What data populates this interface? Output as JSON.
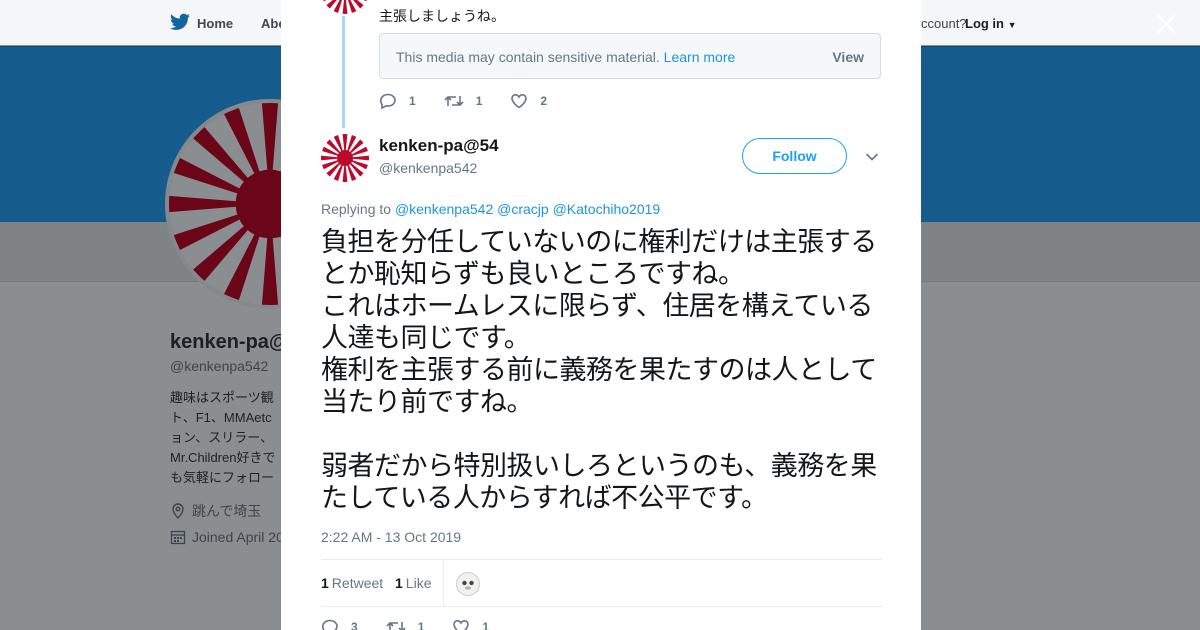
{
  "background": {
    "nav": {
      "home": "Home",
      "about": "Abo",
      "account_prompt": "ccount?",
      "login": "Log in"
    },
    "profile": {
      "name": "kenken-pa@",
      "handle": "@kenkenpa542",
      "bio_lines": [
        "趣味はスポーツ観",
        "ト、F1、MMAetc",
        "ョン、スリラー、",
        "Mr.Children好きで",
        "も気軽にフォロー"
      ],
      "location": "跳んで埼玉",
      "joined": "Joined April 20"
    }
  },
  "modal": {
    "previous_tweet": {
      "text_tail": "主張しましょうね。",
      "sensitive_notice": "This media may contain sensitive material.",
      "learn_more": "Learn more",
      "view": "View",
      "reply_count": "1",
      "retweet_count": "1",
      "like_count": "2"
    },
    "tweet": {
      "author_name": "kenken-pa@54",
      "author_handle": "@kenkenpa542",
      "follow_label": "Follow",
      "replying_prefix": "Replying to",
      "replying_to": [
        "@kenkenpa542",
        "@cracjp",
        "@Katochiho2019"
      ],
      "paragraphs": [
        "負担を分任していないのに権利だけは主張するとか恥知らずも良いところですね。",
        "これはホームレスに限らず、住居を構えている人達も同じです。",
        "権利を主張する前に義務を果たすのは人として当たり前ですね。",
        "",
        "弱者だから特別扱いしろというのも、義務を果たしている人からすれば不公平です。"
      ],
      "timestamp": "2:22 AM - 13 Oct 2019",
      "retweets_count": "1",
      "retweets_label": "Retweet",
      "likes_count": "1",
      "likes_label": "Like",
      "reply_count": "3",
      "retweet_count": "1",
      "like_count": "1"
    }
  },
  "colors": {
    "accent": "#1da1f2",
    "link": "#1b95e0",
    "thread": "#a8d6f4",
    "flag_red": "#bc0a2c"
  }
}
